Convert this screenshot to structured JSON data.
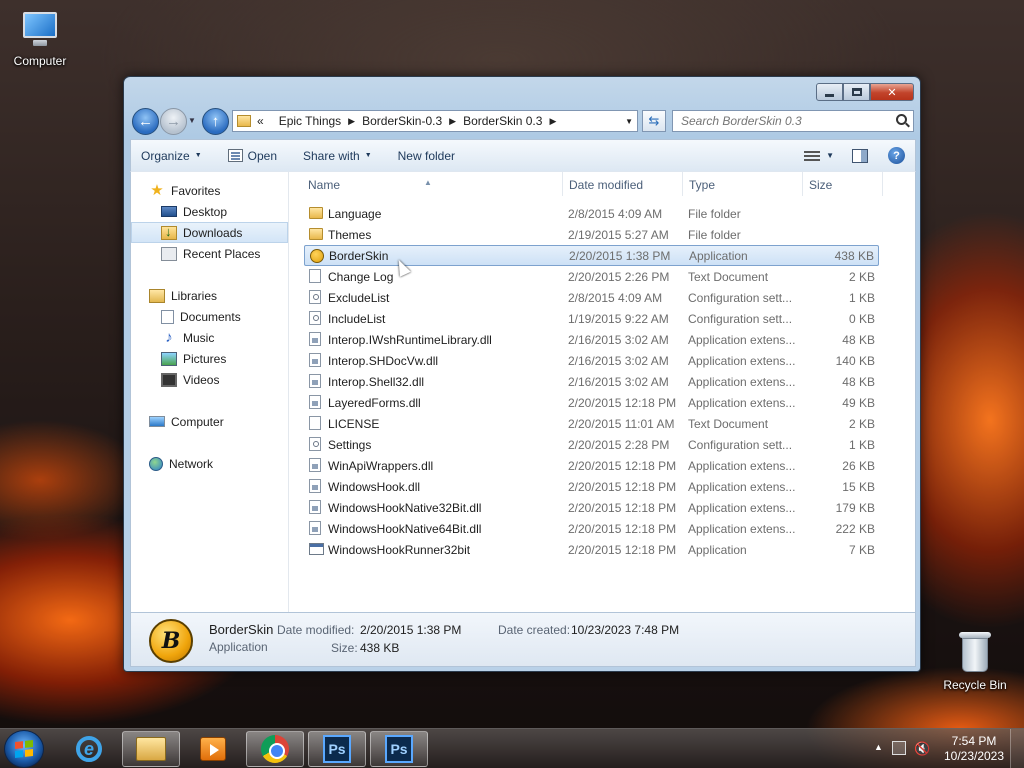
{
  "desktop": {
    "icons": [
      {
        "label": "Computer",
        "icon": "computer-icon"
      },
      {
        "label": "Recycle Bin",
        "icon": "recycle-bin-icon"
      }
    ]
  },
  "window": {
    "controls": {
      "minimize": "minimize",
      "maximize": "maximize",
      "close": "close"
    },
    "address": {
      "overflow": "«",
      "crumbs": [
        "Epic Things",
        "BorderSkin-0.3",
        "BorderSkin 0.3"
      ]
    },
    "search": {
      "placeholder": "Search BorderSkin 0.3"
    },
    "toolbar": {
      "organize": "Organize",
      "open": "Open",
      "share_with": "Share with",
      "new_folder": "New folder"
    },
    "nav": {
      "favorites": {
        "label": "Favorites",
        "items": [
          "Desktop",
          "Downloads",
          "Recent Places"
        ]
      },
      "libraries": {
        "label": "Libraries",
        "items": [
          "Documents",
          "Music",
          "Pictures",
          "Videos"
        ]
      },
      "computer": "Computer",
      "network": "Network",
      "selected": "Downloads"
    },
    "columns": {
      "name": "Name",
      "date": "Date modified",
      "type": "Type",
      "size": "Size"
    },
    "files": [
      {
        "name": "Language",
        "date": "2/8/2015 4:09 AM",
        "type": "File folder",
        "size": "",
        "icon": "folder"
      },
      {
        "name": "Themes",
        "date": "2/19/2015 5:27 AM",
        "type": "File folder",
        "size": "",
        "icon": "folder"
      },
      {
        "name": "BorderSkin",
        "date": "2/20/2015 1:38 PM",
        "type": "Application",
        "size": "438 KB",
        "icon": "app-bs",
        "selected": true
      },
      {
        "name": "Change Log",
        "date": "2/20/2015 2:26 PM",
        "type": "Text Document",
        "size": "2 KB",
        "icon": "text"
      },
      {
        "name": "ExcludeList",
        "date": "2/8/2015 4:09 AM",
        "type": "Configuration sett...",
        "size": "1 KB",
        "icon": "cfg"
      },
      {
        "name": "IncludeList",
        "date": "1/19/2015 9:22 AM",
        "type": "Configuration sett...",
        "size": "0 KB",
        "icon": "cfg"
      },
      {
        "name": "Interop.IWshRuntimeLibrary.dll",
        "date": "2/16/2015 3:02 AM",
        "type": "Application extens...",
        "size": "48 KB",
        "icon": "dll"
      },
      {
        "name": "Interop.SHDocVw.dll",
        "date": "2/16/2015 3:02 AM",
        "type": "Application extens...",
        "size": "140 KB",
        "icon": "dll"
      },
      {
        "name": "Interop.Shell32.dll",
        "date": "2/16/2015 3:02 AM",
        "type": "Application extens...",
        "size": "48 KB",
        "icon": "dll"
      },
      {
        "name": "LayeredForms.dll",
        "date": "2/20/2015 12:18 PM",
        "type": "Application extens...",
        "size": "49 KB",
        "icon": "dll"
      },
      {
        "name": "LICENSE",
        "date": "2/20/2015 11:01 AM",
        "type": "Text Document",
        "size": "2 KB",
        "icon": "text"
      },
      {
        "name": "Settings",
        "date": "2/20/2015 2:28 PM",
        "type": "Configuration sett...",
        "size": "1 KB",
        "icon": "cfg"
      },
      {
        "name": "WinApiWrappers.dll",
        "date": "2/20/2015 12:18 PM",
        "type": "Application extens...",
        "size": "26 KB",
        "icon": "dll"
      },
      {
        "name": "WindowsHook.dll",
        "date": "2/20/2015 12:18 PM",
        "type": "Application extens...",
        "size": "15 KB",
        "icon": "dll"
      },
      {
        "name": "WindowsHookNative32Bit.dll",
        "date": "2/20/2015 12:18 PM",
        "type": "Application extens...",
        "size": "179 KB",
        "icon": "dll"
      },
      {
        "name": "WindowsHookNative64Bit.dll",
        "date": "2/20/2015 12:18 PM",
        "type": "Application extens...",
        "size": "222 KB",
        "icon": "dll"
      },
      {
        "name": "WindowsHookRunner32bit",
        "date": "2/20/2015 12:18 PM",
        "type": "Application",
        "size": "7 KB",
        "icon": "exe"
      }
    ],
    "details": {
      "name": "BorderSkin",
      "type": "Application",
      "modified_label": "Date modified:",
      "modified": "2/20/2015 1:38 PM",
      "created_label": "Date created:",
      "created": "10/23/2023 7:48 PM",
      "size_label": "Size:",
      "size": "438 KB",
      "thumb_text": "B"
    }
  },
  "taskbar": {
    "apps": [
      "internet-explorer",
      "windows-explorer",
      "media-player",
      "chrome",
      "photoshop-1",
      "photoshop-2"
    ],
    "ps_label": "Ps",
    "clock": {
      "time": "7:54 PM",
      "date": "10/23/2023"
    }
  }
}
